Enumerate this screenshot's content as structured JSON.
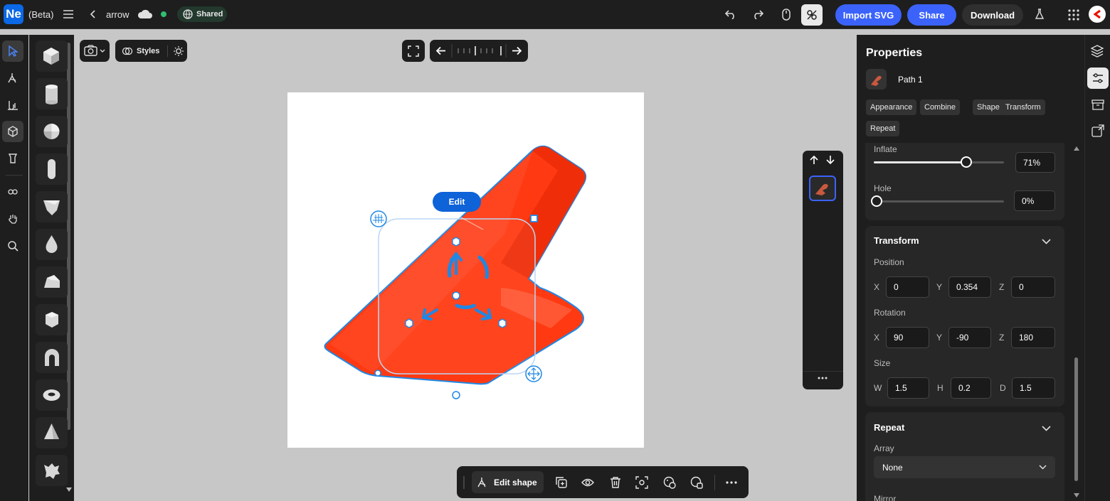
{
  "app": {
    "logo": "Ne",
    "beta": "(Beta)",
    "doc_title": "arrow",
    "shared_label": "Shared"
  },
  "topbar": {
    "import_label": "Import SVG",
    "share_label": "Share",
    "download_label": "Download"
  },
  "toolbar": {
    "styles_label": "Styles"
  },
  "canvas": {
    "edit_label": "Edit"
  },
  "properties": {
    "title": "Properties",
    "object_name": "Path 1",
    "tabs": [
      "Appearance",
      "Combine",
      "Shape",
      "Transform",
      "Repeat"
    ],
    "inflate": {
      "label": "Inflate",
      "value": "71%",
      "level": 0.71
    },
    "hole": {
      "label": "Hole",
      "value": "0%",
      "level": 0.0
    },
    "transform": {
      "title": "Transform",
      "position_label": "Position",
      "position": {
        "x": "0",
        "y": "0.354",
        "z": "0"
      },
      "rotation_label": "Rotation",
      "rotation": {
        "x": "90",
        "y": "-90",
        "z": "180"
      },
      "size_label": "Size",
      "size": {
        "w": "1.5",
        "h": "0.2",
        "d": "1.5"
      }
    },
    "repeat": {
      "title": "Repeat",
      "array_label": "Array",
      "array_value": "None",
      "mirror_label": "Mirror"
    }
  },
  "axis_letters": {
    "x": "X",
    "y": "Y",
    "z": "Z",
    "w": "W",
    "h": "H",
    "d": "D"
  },
  "bottombar": {
    "edit_shape_label": "Edit shape"
  },
  "colors": {
    "accent": "#3b63fb",
    "shape": "#ff3a12",
    "selection": "#1e88e5",
    "panel": "#1e1e1e"
  }
}
